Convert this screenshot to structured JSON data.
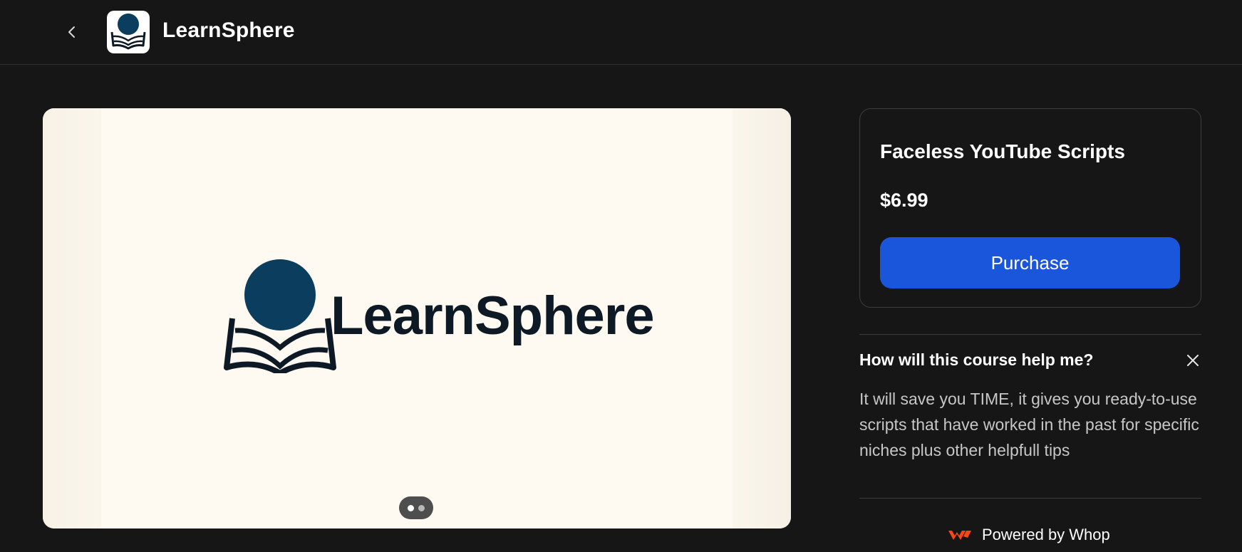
{
  "header": {
    "back_icon": "chevron-left-icon",
    "app_name": "LearnSphere",
    "logo_icon": "learnsphere-logo-icon"
  },
  "hero": {
    "brand_name": "LearnSphere",
    "brand_color": "#0b3d5e",
    "carousel_slide_count": 2,
    "carousel_active_index": 0
  },
  "product": {
    "title": "Faceless YouTube Scripts",
    "price": "$6.99",
    "purchase_label": "Purchase",
    "accent_color": "#1a56db"
  },
  "faq": {
    "question": "How will this course help me?",
    "answer": "It will save you TIME, it gives you ready-to-use scripts that have worked in the past for specific niches plus other helpfull tips",
    "close_icon": "close-icon"
  },
  "footer": {
    "powered_label": "Powered by Whop",
    "whop_icon": "whop-logo-icon",
    "whop_color": "#fa4616"
  }
}
